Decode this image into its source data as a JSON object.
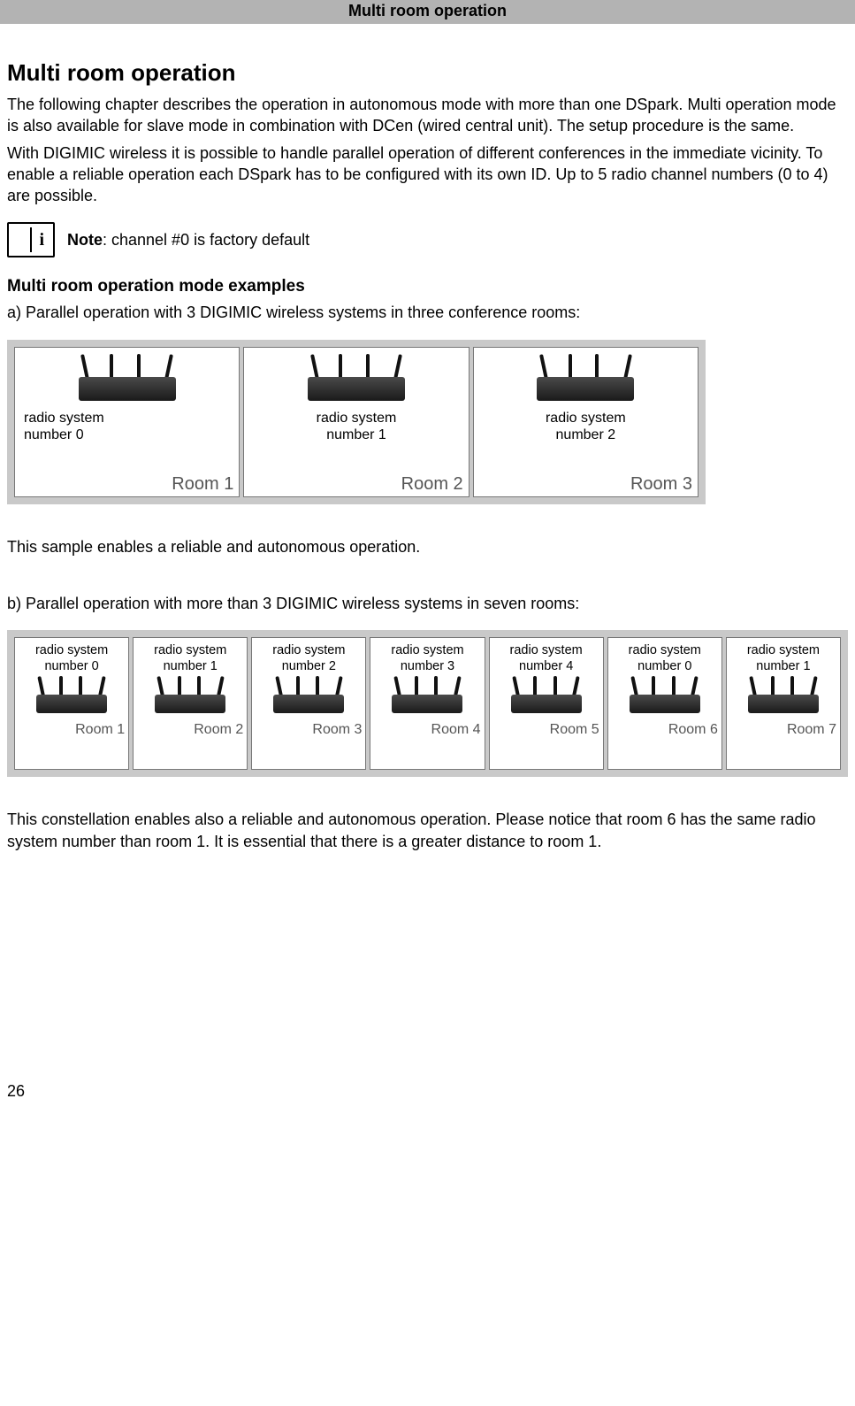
{
  "header": {
    "title": "Multi room operation"
  },
  "section": {
    "title": "Multi room operation",
    "p1": "The following chapter describes the operation in autonomous mode with more than one DSpark. Multi operation mode is also available for slave mode in combination with DCen (wired central unit). The setup procedure is the same.",
    "p2": "With DIGIMIC wireless it is possible to handle parallel operation of different conferences in the immediate vicinity. To enable a reliable operation each DSpark has to be configured with its own ID. Up to 5 radio channel numbers (0 to 4) are possible."
  },
  "note": {
    "label": "Note",
    "text": ": channel #0 is factory default"
  },
  "examples": {
    "heading": "Multi room operation mode examples",
    "a_intro": "a) Parallel operation with 3 DIGIMIC wireless systems in three conference rooms:",
    "a_rooms": [
      {
        "rs1": "radio system",
        "rs2": "number 0",
        "room": "Room 1"
      },
      {
        "rs1": "radio system",
        "rs2": "number 1",
        "room": "Room 2"
      },
      {
        "rs1": "radio system",
        "rs2": "number 2",
        "room": "Room 3"
      }
    ],
    "a_outro": "This sample enables a reliable and autonomous operation.",
    "b_intro": "b) Parallel operation with more than 3 DIGIMIC wireless systems in seven rooms:",
    "b_rooms": [
      {
        "rs1": "radio system",
        "rs2": "number 0",
        "room": "Room 1"
      },
      {
        "rs1": "radio system",
        "rs2": "number 1",
        "room": "Room 2"
      },
      {
        "rs1": "radio system",
        "rs2": "number 2",
        "room": "Room 3"
      },
      {
        "rs1": "radio system",
        "rs2": "number 3",
        "room": "Room 4"
      },
      {
        "rs1": "radio system",
        "rs2": "number 4",
        "room": "Room 5"
      },
      {
        "rs1": "radio system",
        "rs2": "number 0",
        "room": "Room 6"
      },
      {
        "rs1": "radio system",
        "rs2": "number 1",
        "room": "Room 7"
      }
    ],
    "b_outro": "This constellation enables also a reliable and autonomous operation. Please notice that room 6 has the same radio system number than room 1. It is essential that there is a greater distance to room 1."
  },
  "page_number": "26"
}
